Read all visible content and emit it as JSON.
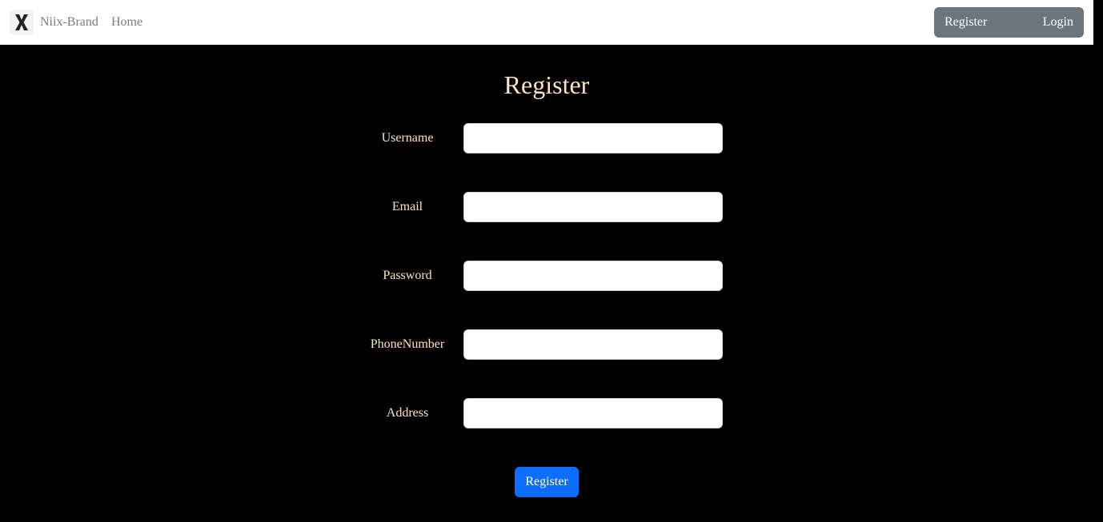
{
  "navbar": {
    "brand_name": "Niix-Brand",
    "home_link": "Home",
    "register_link": "Register",
    "login_link": "Login",
    "logo_icon": "x-logo-icon"
  },
  "form": {
    "title": "Register",
    "fields": [
      {
        "label": "Username",
        "value": "",
        "placeholder": ""
      },
      {
        "label": "Email",
        "value": "",
        "placeholder": ""
      },
      {
        "label": "Password",
        "value": "",
        "placeholder": ""
      },
      {
        "label": "PhoneNumber",
        "value": "",
        "placeholder": ""
      },
      {
        "label": "Address",
        "value": "",
        "placeholder": ""
      }
    ],
    "submit_label": "Register"
  },
  "colors": {
    "page_background": "#000000",
    "label_text": "#ffe4c4",
    "primary_button": "#0d6efd",
    "secondary_button": "#6c757d"
  }
}
